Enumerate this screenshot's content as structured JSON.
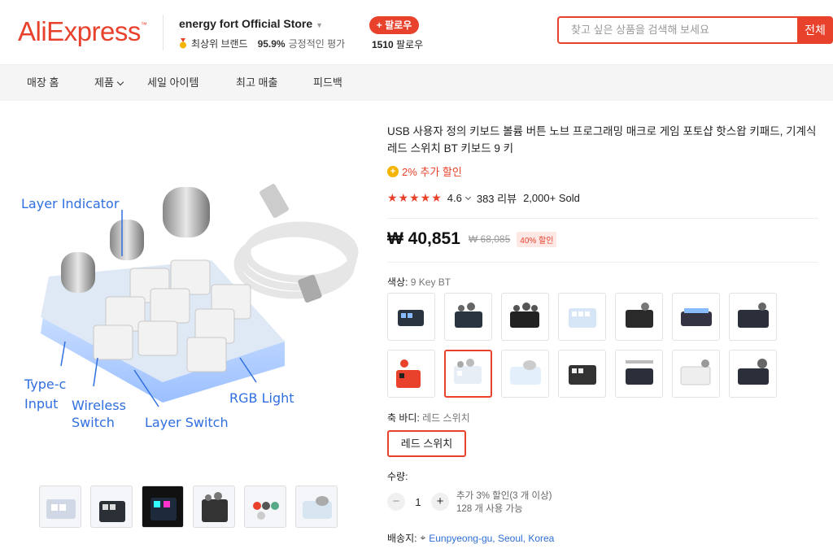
{
  "header": {
    "logo": "AliExpress",
    "store_name": "energy fort Official Store",
    "brand_badge": "최상위 브랜드",
    "positive_pct": "95.9%",
    "positive_label": "긍정적인 평가",
    "follow_label": "+ 팔로우",
    "follower_count": "1510",
    "follower_label": "팔로우",
    "search_placeholder": "찾고 싶은 상품을 검색해 보세요",
    "search_scope": "전체"
  },
  "nav": {
    "items": [
      "매장 홈",
      "제품",
      "세일 아이템",
      "최고 매출",
      "피드백"
    ]
  },
  "gallery": {
    "callouts": [
      "Layer Indicator",
      "Type-c Input",
      "Wireless Switch",
      "Layer Switch",
      "RGB Light"
    ],
    "thumb_count": 6
  },
  "product": {
    "title": "USB 사용자 정의 키보드 볼륨 버튼 노브 프로그래밍 매크로 게임 포토샵 핫스왑 키패드, 기계식 레드 스위치 BT 키보드 9 키",
    "bonus": "2% 추가 할인",
    "rating": "4.6",
    "review_count": "383 리뷰",
    "sold": "2,000+ Sold",
    "price": "₩ 40,851",
    "old_price": "₩ 68,085",
    "discount": "40% 할인",
    "color_label": "색상:",
    "color_value": "9 Key BT",
    "switch_label": "축 바디:",
    "switch_value": "레드 스위치",
    "switch_option": "레드 스위치",
    "qty_label": "수량:",
    "qty_value": "1",
    "qty_bonus": "추가 3% 할인(3 개 이상)",
    "qty_stock": "128 개 사용 가능",
    "ship_label": "배송지:",
    "ship_location": "Eunpyeong-gu, Seoul, Korea"
  },
  "colors": {
    "accent": "#e8412c",
    "link": "#2e6fd6",
    "star": "#e8412c"
  }
}
